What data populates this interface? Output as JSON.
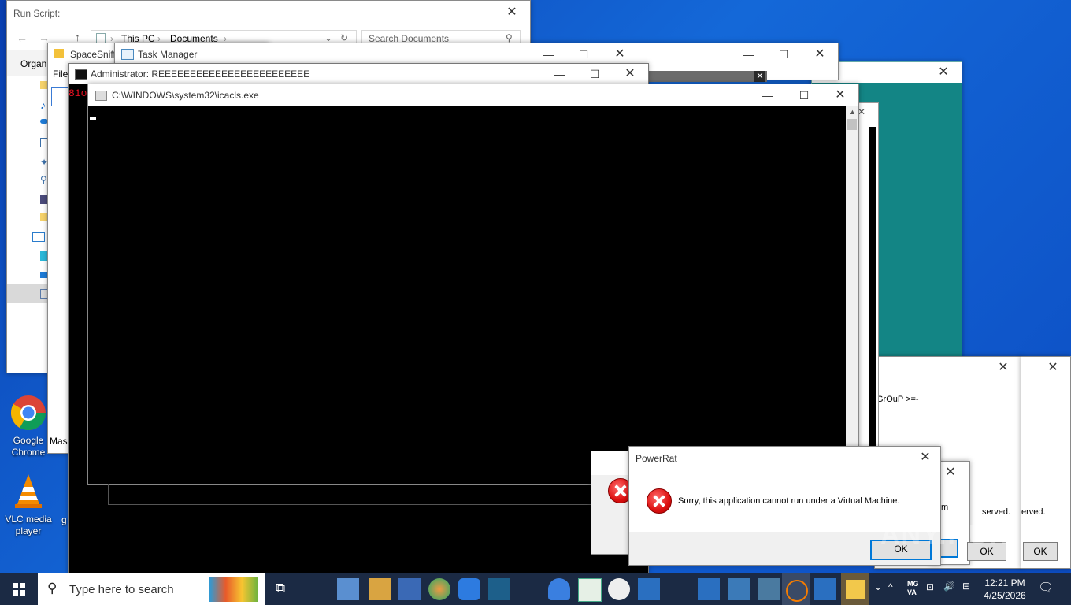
{
  "explorer": {
    "title": "Run Script:",
    "breadcrumb": [
      "This PC",
      "Documents"
    ],
    "search_placeholder": "Search Documents",
    "organize_label": "Organ",
    "file_label": "File"
  },
  "spacesniffer": {
    "title": "SpaceSniff"
  },
  "task_manager": {
    "title": "Task Manager"
  },
  "admin_cmd": {
    "title": "Administrator:  REEEEEEEEEEEEEEEEEEEEEEEE",
    "red_text": "81o"
  },
  "icacls": {
    "title": "C:\\WINDOWS\\system32\\icacls.exe"
  },
  "bg_dialogs": {
    "group_text": "GrOuP >=-",
    "reserved_1": "served.",
    "reserved_2": "erved.",
    "m_text": "m",
    "ok_1": "OK",
    "ok_2": "OK",
    "mas_label": "Mas"
  },
  "powerrat": {
    "title": "PowerRat",
    "message": "Sorry, this application cannot run under a Virtual Machine.",
    "ok": "OK"
  },
  "desktop": {
    "icons": [
      {
        "label": "Google Chrome"
      },
      {
        "label": "VLC media player"
      }
    ],
    "partial_label": "g"
  },
  "taskbar": {
    "search_placeholder": "Type here to search",
    "time": "12:21 PM",
    "date": "4/25/2026",
    "lang_top": "MG",
    "lang_bottom": "VA"
  },
  "watermark": "ANY.RUN",
  "colors": {
    "accent": "#0078d7",
    "teal_window": "#138585",
    "taskbar": "#1b2a44"
  }
}
